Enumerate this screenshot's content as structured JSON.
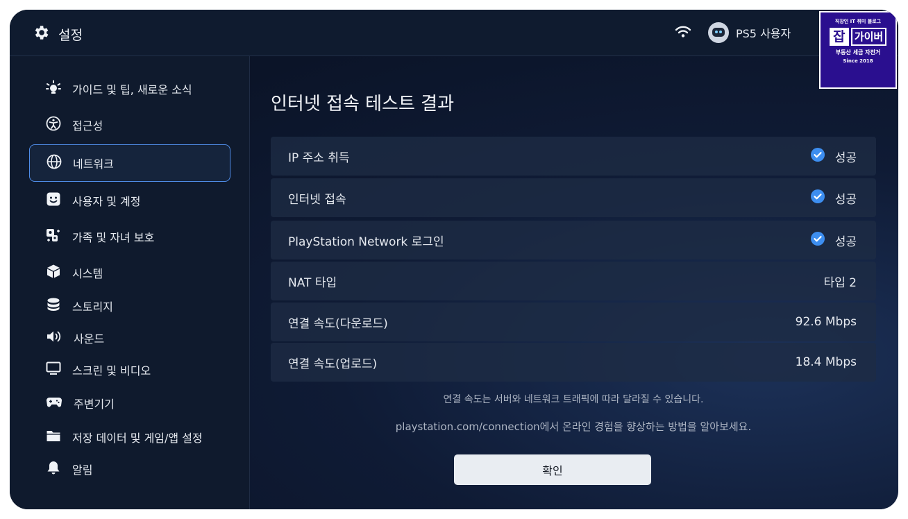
{
  "header": {
    "title": "설정",
    "user_name": "PS5 사용자"
  },
  "badge": {
    "line1": "직장인 IT 취미 블로그",
    "jab": "잡",
    "name": "가이버",
    "line3": "부동산 세금 자전거",
    "line4": "Since 2018"
  },
  "sidebar": {
    "items": [
      {
        "label": "가이드 및 팁, 새로운 소식",
        "icon": "lightbulb-icon"
      },
      {
        "label": "접근성",
        "icon": "accessibility-icon"
      },
      {
        "label": "네트워크",
        "icon": "globe-icon",
        "active": true
      },
      {
        "label": "사용자 및 계정",
        "icon": "user-face-icon"
      },
      {
        "label": "가족 및 자녀 보호",
        "icon": "family-icon"
      },
      {
        "label": "시스템",
        "icon": "cube-icon"
      },
      {
        "label": "스토리지",
        "icon": "database-icon"
      },
      {
        "label": "사운드",
        "icon": "speaker-icon"
      },
      {
        "label": "스크린 및 비디오",
        "icon": "monitor-icon"
      },
      {
        "label": "주변기기",
        "icon": "gamepad-icon"
      },
      {
        "label": "저장 데이터 및 게임/앱 설정",
        "icon": "folder-icon"
      },
      {
        "label": "알림",
        "icon": "bell-icon"
      }
    ]
  },
  "main": {
    "title": "인터넷 접속 테스트 결과",
    "results": [
      {
        "label": "IP 주소 취득",
        "value": "성공",
        "check": true
      },
      {
        "label": "인터넷 접속",
        "value": "성공",
        "check": true
      },
      {
        "label": "PlayStation Network 로그인",
        "value": "성공",
        "check": true
      },
      {
        "label": "NAT 타입",
        "value": "타입 2"
      },
      {
        "label": "연결 속도(다운로드)",
        "value": "92.6 Mbps"
      },
      {
        "label": "연결 속도(업로드)",
        "value": "18.4 Mbps"
      }
    ],
    "note1": "연결 속도는 서버와 네트워크 트래픽에 따라 달라질 수 있습니다.",
    "note2": "playstation.com/connection에서 온라인 경험을 향상하는 방법을 알아보세요.",
    "confirm_label": "확인"
  },
  "colors": {
    "accent": "#4f8de8",
    "check": "#3d8ef0"
  }
}
